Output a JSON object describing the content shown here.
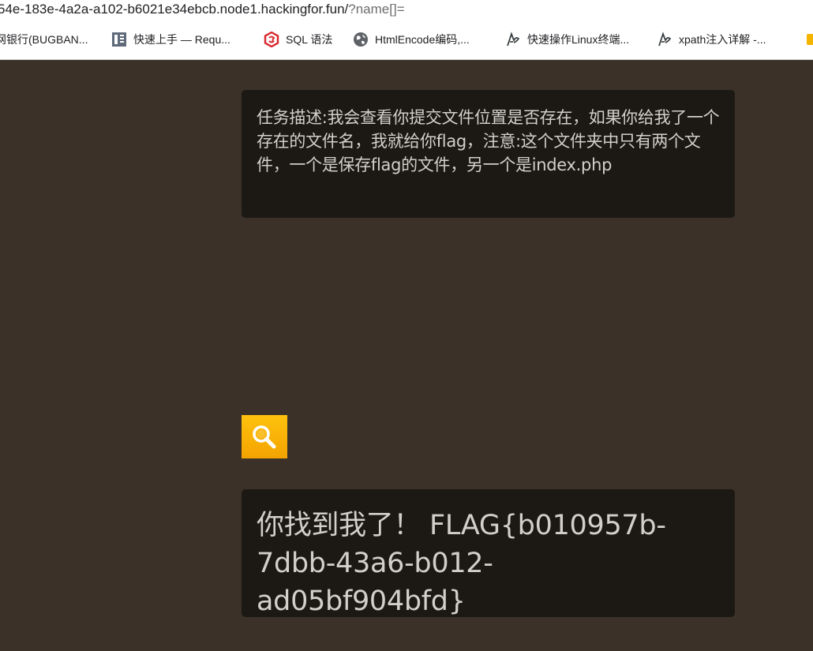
{
  "browser": {
    "url_host": "54e-183e-4a2a-a102-b6021e34ebcb.node1.hackingfor.fun/",
    "url_path": "?name[]=",
    "bookmarks": [
      {
        "label": "网银行(BUGBAN...",
        "icon": "favicon-icon"
      },
      {
        "label": "快速上手 — Requ...",
        "icon": "document-book-icon"
      },
      {
        "label": "SQL 语法",
        "icon": "sql-hexagon-icon"
      },
      {
        "label": "HtmlEncode编码,...",
        "icon": "globe-icon"
      },
      {
        "label": "快速操作Linux终端...",
        "icon": "quill-icon"
      },
      {
        "label": "xpath注入详解 -...",
        "icon": "quill-icon"
      }
    ]
  },
  "page": {
    "task_description": "任务描述:我会查看你提交文件位置是否存在，如果你给我了一个存在的文件名，我就给你flag，注意:这个文件夹中只有两个文件，一个是保存flag的文件，另一个是index.php",
    "search_button_icon": "magnifier-icon",
    "result_text": "你找到我了！ FLAG{b010957b-7dbb-43a6-b012-ad05bf904bfd}"
  },
  "colors": {
    "background": "#3b3128",
    "panel": "#1c1915",
    "panel_text": "#d3d0cb",
    "search_button": "#f9b400"
  }
}
